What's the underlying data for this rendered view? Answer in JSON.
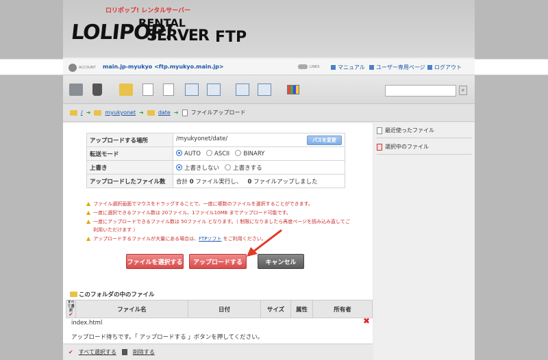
{
  "header": {
    "logo_tag": "ロリポップ! レンタルサーバー",
    "logo_main": "LOLIPOP!",
    "logo_rental": "RENTAL",
    "logo_server": "SERVER",
    "logo_ftp": "FTP"
  },
  "account": {
    "label": "ACCOUNT",
    "name": "main.jp-myukyo <ftp.myukyo.main.jp>",
    "links_label": "LINKS",
    "links": [
      "マニュアル",
      "ユーザー専用ページ",
      "ログアウト"
    ]
  },
  "breadcrumb": {
    "root": "/",
    "items": [
      "myukyonet",
      "date"
    ],
    "current": "ファイルアップロード"
  },
  "sidebar": {
    "items": [
      "最近使ったファイル",
      "選択中のファイル"
    ]
  },
  "form": {
    "location_label": "アップロードする場所",
    "location_value": "/myukyonet/date/",
    "change_path_button": "パスを変更",
    "mode_label": "転送モード",
    "mode_options": [
      "AUTO",
      "ASCII",
      "BINARY"
    ],
    "mode_selected": "AUTO",
    "overwrite_label": "上書き",
    "overwrite_options": [
      "上書きしない",
      "上書きする"
    ],
    "overwrite_selected": "上書きしない",
    "uploaded_label": "アップロードしたファイル数",
    "uploaded_prefix": "合計",
    "executed_count": "0",
    "executed_suffix": "ファイル実行し、",
    "uploaded_count": "0",
    "uploaded_suffix": "ファイルアップしました"
  },
  "notes": [
    "ファイル選択画面でマウスをドラッグすることで、一度に複数のファイルを選択することができます。",
    "一度に選択できるファイル数は 20ファイル、1ファイル10MB までアップロード可能です。",
    "一度にアップロードできるファイル数は 50ファイル となります。（ 制限になりましたら再度ページを読み込み直してご利用いただけます ）"
  ],
  "note_ftp_prefix": "アップロードするファイルが大量にある場合は、",
  "note_ftp_link": "FTPソフト",
  "note_ftp_suffix": "をご利用ください。",
  "buttons": {
    "select_files": "ファイルを選択する",
    "upload": "アップロードする",
    "cancel": "キャンセル"
  },
  "folder_files": {
    "title": "このフォルダの中のファイル",
    "select_all_head": "すべて選択",
    "columns": [
      "ファイル名",
      "日付",
      "サイズ",
      "属性",
      "所有者"
    ],
    "file_name": "index.html",
    "wait_message": "アップロード待ちです。「 アップロードする 」ボタンを押してください。"
  },
  "footer": {
    "select_all": "すべて選択する",
    "delete": "削除する"
  }
}
